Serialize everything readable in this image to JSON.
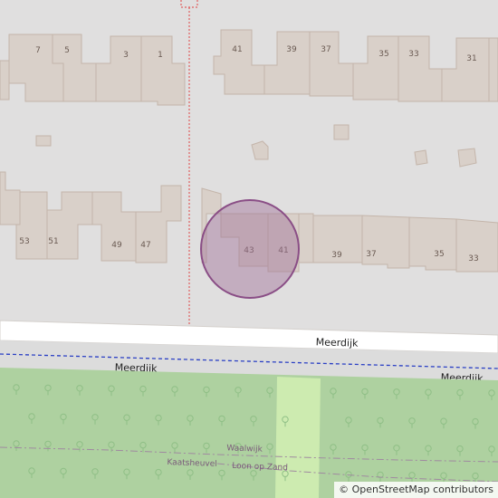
{
  "map": {
    "house_numbers_top_left": [
      "7",
      "5",
      "3",
      "1"
    ],
    "house_numbers_top_right": [
      "41",
      "39",
      "37",
      "35",
      "33",
      "31"
    ],
    "house_numbers_bottom_left": [
      "53",
      "51",
      "49",
      "47"
    ],
    "house_numbers_bottom_right": [
      "43",
      "41",
      "39",
      "37",
      "35",
      "33"
    ],
    "road_main_label": "Meerdijk",
    "road_lower_label_left": "Meerdijk",
    "road_lower_label_right": "Meerdijk",
    "boundary_labels": [
      "Waalwijk",
      "Kaatsheuvel",
      "Loon op Zand"
    ],
    "marker_color": "#a0729a"
  },
  "attribution": {
    "symbol": "©",
    "text": "OpenStreetMap contributors"
  }
}
